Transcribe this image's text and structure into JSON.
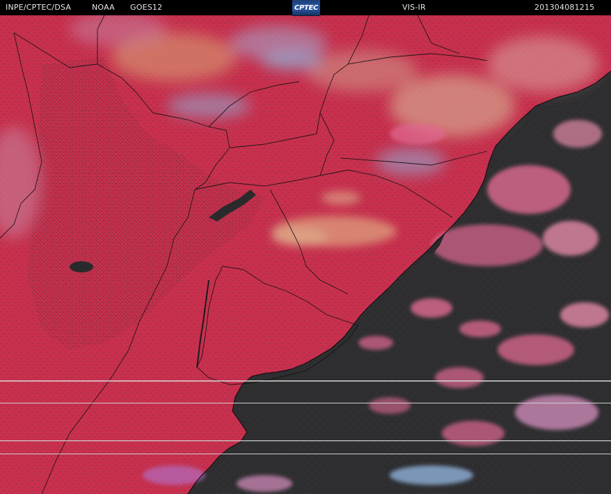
{
  "header": {
    "agency": "INPE/CPTEC/DSA",
    "provider": "NOAA",
    "satellite": "GOES12",
    "logo_text": "CPTEC",
    "channel": "VIS-IR",
    "timestamp": "201304081215"
  },
  "colors": {
    "land_clear": "#c8304e",
    "ocean_clear": "#2e2e30",
    "high_cloud": "#8fb0d8",
    "mid_cloud": "#d8a878",
    "low_cloud": "#e06a92",
    "boundary_line": "#111111",
    "scan_artifact": "#d8d8d8"
  }
}
